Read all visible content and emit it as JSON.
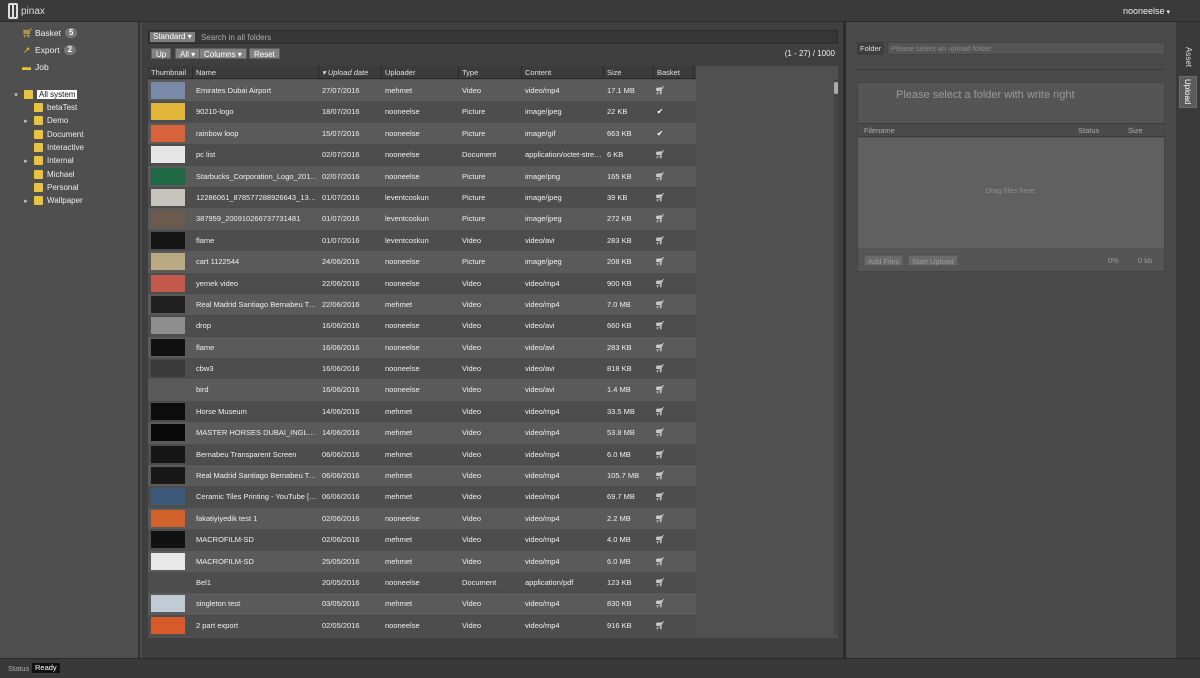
{
  "app": {
    "logo_text": "pinax",
    "user": "nooneelse"
  },
  "sidebar": {
    "basket": {
      "label": "Basket",
      "count": "5"
    },
    "export": {
      "label": "Export",
      "count": "2"
    },
    "job": {
      "label": "Job"
    },
    "tree": [
      {
        "label": "All system",
        "selected": true,
        "arrow": "▾"
      },
      {
        "label": "betaTest",
        "arrow": ""
      },
      {
        "label": "Demo",
        "arrow": "▸"
      },
      {
        "label": "Document",
        "arrow": ""
      },
      {
        "label": "Interactive",
        "arrow": ""
      },
      {
        "label": "Internal",
        "arrow": "▸"
      },
      {
        "label": "Michael",
        "arrow": ""
      },
      {
        "label": "Personal",
        "arrow": ""
      },
      {
        "label": "Wallpaper",
        "arrow": "▸"
      }
    ]
  },
  "toolbar": {
    "scope": "Standard ▾",
    "search_placeholder": "Search in all folders",
    "up": "Up",
    "all": "All ▾",
    "columns": "Columns ▾",
    "reset": "Reset",
    "count": "(1 - 27) / 1000"
  },
  "grid": {
    "headers": {
      "thumbnail": "Thumbnail",
      "name": "Name",
      "date": "▾ Upload date",
      "uploader": "Uploader",
      "type": "Type",
      "content": "Content",
      "size": "Size",
      "basket": "Basket"
    },
    "rows": [
      {
        "name": "Emirates Dubai Airport",
        "date": "27/07/2016",
        "uploader": "mehmet",
        "type": "Video",
        "content": "video/mp4",
        "size": "17.1 MB",
        "basket": "cart",
        "thumb": "#7a8aa8"
      },
      {
        "name": "90210-logo",
        "date": "18/07/2016",
        "uploader": "nooneelse",
        "type": "Picture",
        "content": "image/jpeg",
        "size": "22 KB",
        "basket": "check",
        "thumb": "#e2b63a"
      },
      {
        "name": "rainbow loop",
        "date": "15/07/2016",
        "uploader": "nooneelse",
        "type": "Picture",
        "content": "image/gif",
        "size": "663 KB",
        "basket": "check",
        "thumb": "#d8633a"
      },
      {
        "name": "pc list",
        "date": "02/07/2016",
        "uploader": "nooneelse",
        "type": "Document",
        "content": "application/octet-stream",
        "size": "6 KB",
        "basket": "cart",
        "thumb": "#e6e6e6"
      },
      {
        "name": "Starbucks_Corporation_Logo_2011.svg",
        "date": "02/07/2016",
        "uploader": "nooneelse",
        "type": "Picture",
        "content": "image/png",
        "size": "165 KB",
        "basket": "cart",
        "thumb": "#1f6a44"
      },
      {
        "name": "12286061_878577288926643_132702...",
        "date": "01/07/2016",
        "uploader": "leventcoskun",
        "type": "Picture",
        "content": "image/jpeg",
        "size": "39 KB",
        "basket": "cart",
        "thumb": "#c7c3bd"
      },
      {
        "name": "387959_200910266737731481",
        "date": "01/07/2016",
        "uploader": "leventcoskun",
        "type": "Picture",
        "content": "image/jpeg",
        "size": "272 KB",
        "basket": "cart",
        "thumb": "#6c5a4e"
      },
      {
        "name": "flame",
        "date": "01/07/2016",
        "uploader": "leventcoskun",
        "type": "Video",
        "content": "video/avi",
        "size": "283 KB",
        "basket": "cart",
        "thumb": "#151515"
      },
      {
        "name": "cart 1122544",
        "date": "24/06/2016",
        "uploader": "nooneelse",
        "type": "Picture",
        "content": "image/jpeg",
        "size": "208 KB",
        "basket": "cart",
        "thumb": "#b9aa84"
      },
      {
        "name": "yemek video",
        "date": "22/06/2016",
        "uploader": "nooneelse",
        "type": "Video",
        "content": "video/mp4",
        "size": "900 KB",
        "basket": "cart",
        "thumb": "#c35a4c"
      },
      {
        "name": "Real Madrid Santiago Bernabeu Tour i...",
        "date": "22/06/2016",
        "uploader": "mehmet",
        "type": "Video",
        "content": "video/mp4",
        "size": "7.0 MB",
        "basket": "cart",
        "thumb": "#202020"
      },
      {
        "name": "drop",
        "date": "16/06/2016",
        "uploader": "nooneelse",
        "type": "Video",
        "content": "video/avi",
        "size": "660 KB",
        "basket": "cart",
        "thumb": "#8e8e8e"
      },
      {
        "name": "flame",
        "date": "16/06/2016",
        "uploader": "nooneelse",
        "type": "Video",
        "content": "video/avi",
        "size": "283 KB",
        "basket": "cart",
        "thumb": "#101010"
      },
      {
        "name": "cbw3",
        "date": "16/06/2016",
        "uploader": "nooneelse",
        "type": "Video",
        "content": "video/avi",
        "size": "818 KB",
        "basket": "cart",
        "thumb": "#3a3a3a"
      },
      {
        "name": "bird",
        "date": "16/06/2016",
        "uploader": "nooneelse",
        "type": "Video",
        "content": "video/avi",
        "size": "1.4 MB",
        "basket": "cart",
        "thumb": "#5a5a5a"
      },
      {
        "name": "Horse Museum",
        "date": "14/06/2016",
        "uploader": "mehmet",
        "type": "Video",
        "content": "video/mp4",
        "size": "33.5 MB",
        "basket": "cart",
        "thumb": "#0c0c0c"
      },
      {
        "name": "MASTER HORSES DUBAI_INGLES s...",
        "date": "14/06/2016",
        "uploader": "mehmet",
        "type": "Video",
        "content": "video/mp4",
        "size": "53.8 MB",
        "basket": "cart",
        "thumb": "#0a0a0a"
      },
      {
        "name": "Bernabeu Transparent Screen",
        "date": "06/06/2016",
        "uploader": "mehmet",
        "type": "Video",
        "content": "video/mp4",
        "size": "6.0 MB",
        "basket": "cart",
        "thumb": "#161616"
      },
      {
        "name": "Real Madrid Santiago Bernabeu Tour i...",
        "date": "06/06/2016",
        "uploader": "mehmet",
        "type": "Video",
        "content": "video/mp4",
        "size": "105.7 MB",
        "basket": "cart",
        "thumb": "#181818"
      },
      {
        "name": "Ceramic Tiles Printing - YouTube [720p]",
        "date": "06/06/2016",
        "uploader": "mehmet",
        "type": "Video",
        "content": "video/mp4",
        "size": "69.7 MB",
        "basket": "cart",
        "thumb": "#3d5a7a"
      },
      {
        "name": "fakatiyiyedik test 1",
        "date": "02/06/2016",
        "uploader": "nooneelse",
        "type": "Video",
        "content": "video/mp4",
        "size": "2.2 MB",
        "basket": "cart",
        "thumb": "#d2622c"
      },
      {
        "name": "MACROFILM-SD",
        "date": "02/06/2016",
        "uploader": "mehmet",
        "type": "Video",
        "content": "video/mp4",
        "size": "4.0 MB",
        "basket": "cart",
        "thumb": "#111111"
      },
      {
        "name": "MACROFILM-SD",
        "date": "25/05/2016",
        "uploader": "mehmet",
        "type": "Video",
        "content": "video/mp4",
        "size": "6.0 MB",
        "basket": "cart",
        "thumb": "#e8e8e8"
      },
      {
        "name": "Bel1",
        "date": "20/05/2016",
        "uploader": "nooneelse",
        "type": "Document",
        "content": "application/pdf",
        "size": "123 KB",
        "basket": "cart",
        "thumb": "#4d4d4d"
      },
      {
        "name": "singleton test",
        "date": "03/05/2016",
        "uploader": "mehmet",
        "type": "Video",
        "content": "video/mp4",
        "size": "830 KB",
        "basket": "cart",
        "thumb": "#c0cbd6"
      },
      {
        "name": "2 part export",
        "date": "02/05/2016",
        "uploader": "nooneelse",
        "type": "Video",
        "content": "video/mp4",
        "size": "916 KB",
        "basket": "cart",
        "thumb": "#d65a2a"
      }
    ]
  },
  "upload": {
    "folder_label": "Folder",
    "folder_placeholder": "Please select an upload folder",
    "message": "Please select a folder with write right",
    "col_filename": "Filename",
    "col_status": "Status",
    "col_size": "Size",
    "drop_text": "Drag files here.",
    "add_files": "Add Files",
    "start_upload": "Start Upload",
    "percent": "0%",
    "total": "0 kb"
  },
  "tabs": {
    "asset": "Asset",
    "upload": "Upload"
  },
  "status": {
    "label": "Status",
    "value": "Ready"
  }
}
